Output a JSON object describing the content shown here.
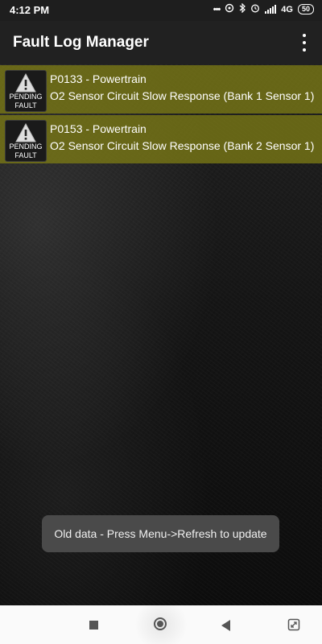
{
  "status_bar": {
    "time": "4:12 PM",
    "overflow_dots": "•••",
    "network": "4G",
    "battery": "50"
  },
  "app_bar": {
    "title": "Fault Log Manager"
  },
  "faults": [
    {
      "code": "P0133 - Powertrain",
      "description": "O2 Sensor Circuit Slow Response (Bank 1 Sensor 1)",
      "badge_line1": "PENDING",
      "badge_line2": "FAULT"
    },
    {
      "code": "P0153 - Powertrain",
      "description": "O2 Sensor Circuit Slow Response (Bank 2 Sensor 1)",
      "badge_line1": "PENDING",
      "badge_line2": "FAULT"
    }
  ],
  "toast": {
    "message": "Old data - Press Menu->Refresh to update"
  },
  "colors": {
    "row_highlight": "#7b7a14",
    "app_bar": "#212121",
    "toast": "#4a4a4a"
  },
  "icons": {
    "status": [
      "dots-icon",
      "hotspot-icon",
      "bluetooth-icon",
      "alarm-icon",
      "signal-icon",
      "battery-icon"
    ],
    "fault": "warning-triangle-icon",
    "nav": [
      "recents-square-icon",
      "home-circle-icon",
      "back-triangle-icon",
      "expand-icon"
    ]
  }
}
